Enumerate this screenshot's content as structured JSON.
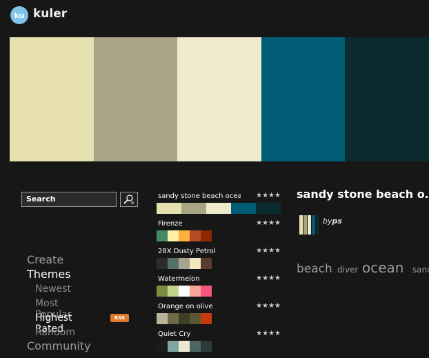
{
  "header": {
    "logo_badge": "ku",
    "app_name": "kuler"
  },
  "banner": {
    "colors": [
      "#E5E0AE",
      "#A8A584",
      "#EEEACA",
      "#005B77",
      "#0B2A2D"
    ]
  },
  "search": {
    "value": "Search"
  },
  "nav": {
    "create": "Create",
    "themes": "Themes",
    "newest": "Newest",
    "most_popular": "Most Popular",
    "highest_rated": "Highest Rated",
    "rss": "RSS",
    "random": "Random",
    "community": "Community"
  },
  "themes": [
    {
      "name": "sandy stone beach ocea...",
      "stars": "★★★★",
      "colors": [
        "#E5E0AE",
        "#A8A584",
        "#EEEACA",
        "#005B77",
        "#0B2A2D"
      ]
    },
    {
      "name": "Firenze",
      "stars": "★★★★",
      "colors": [
        "#468966",
        "#FFF0A5",
        "#FFB03B",
        "#B64926",
        "#8E2800"
      ]
    },
    {
      "name": "28X Dusty Petrol",
      "stars": "★★★★",
      "colors": [
        "#2C2C2C",
        "#56706D",
        "#A7A38E",
        "#F3E8BD",
        "#5A3C33"
      ]
    },
    {
      "name": "Watermelon",
      "stars": "★★★★",
      "colors": [
        "#7A8E3D",
        "#C6D38A",
        "#FFFFFF",
        "#F8A49C",
        "#F3577D"
      ]
    },
    {
      "name": "Orange on olive",
      "stars": "★★★★",
      "colors": [
        "#B9B49A",
        "#6E6B48",
        "#3F3E27",
        "#585832",
        "#C73A0E"
      ]
    },
    {
      "name": "Quiet Cry",
      "stars": "★★★★",
      "colors": [
        "#1C1C1C",
        "#7FA6A1",
        "#EBE9D0",
        "#4D6660",
        "#2D3A39"
      ]
    }
  ],
  "detail": {
    "title": "sandy stone beach o...",
    "by_label": "by",
    "author": "ps",
    "tags": [
      "beach",
      "diver",
      "ocean",
      "sand"
    ]
  }
}
